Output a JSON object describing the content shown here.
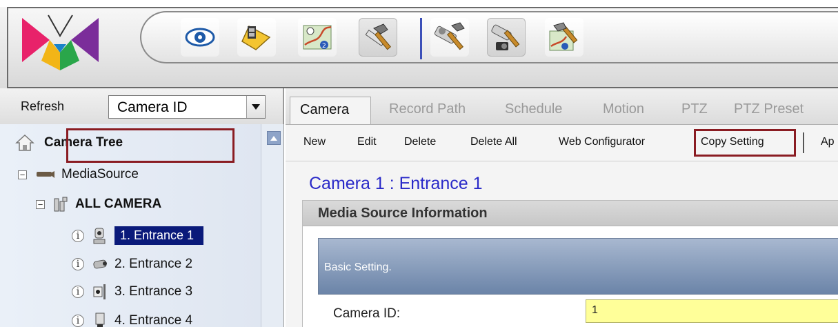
{
  "toolbar": {
    "buttons": [
      {
        "name": "live-view",
        "icon": "eye-icon"
      },
      {
        "name": "playback",
        "icon": "film-icon"
      },
      {
        "name": "emap",
        "icon": "map-icon"
      },
      {
        "name": "setting",
        "icon": "hammer-icon"
      },
      {
        "name": "camera-setting",
        "icon": "tools-icon"
      },
      {
        "name": "device-setting",
        "icon": "camera-tools-icon"
      },
      {
        "name": "map-setting",
        "icon": "map-tools-icon"
      }
    ],
    "accent": "#3b4fb8"
  },
  "left": {
    "refresh_label": "Refresh",
    "select_value": "Camera ID",
    "tree": {
      "root": "Camera Tree",
      "media_source": "MediaSource",
      "all_camera": "ALL CAMERA",
      "cameras": [
        {
          "label": "1. Entrance 1",
          "selected": true
        },
        {
          "label": "2. Entrance 2",
          "selected": false
        },
        {
          "label": "3. Entrance 3",
          "selected": false
        },
        {
          "label": "4. Entrance 4",
          "selected": false
        }
      ]
    }
  },
  "right": {
    "tabs": [
      "Camera",
      "Record Path",
      "Schedule",
      "Motion",
      "PTZ",
      "PTZ Preset"
    ],
    "actions": [
      "New",
      "Edit",
      "Delete",
      "Delete All",
      "Web Configurator",
      "Copy Setting",
      "Ap"
    ],
    "camera_title": "Camera 1 : Entrance 1",
    "section_title": "Media Source Information",
    "basic_setting": "Basic Setting.",
    "camera_id_label": "Camera ID:",
    "camera_id_value": "1"
  },
  "colors": {
    "selection": "#0a1a7a",
    "highlight_border": "#8a1c22",
    "title_blue": "#2929c8",
    "input_yellow": "#ffff99"
  }
}
